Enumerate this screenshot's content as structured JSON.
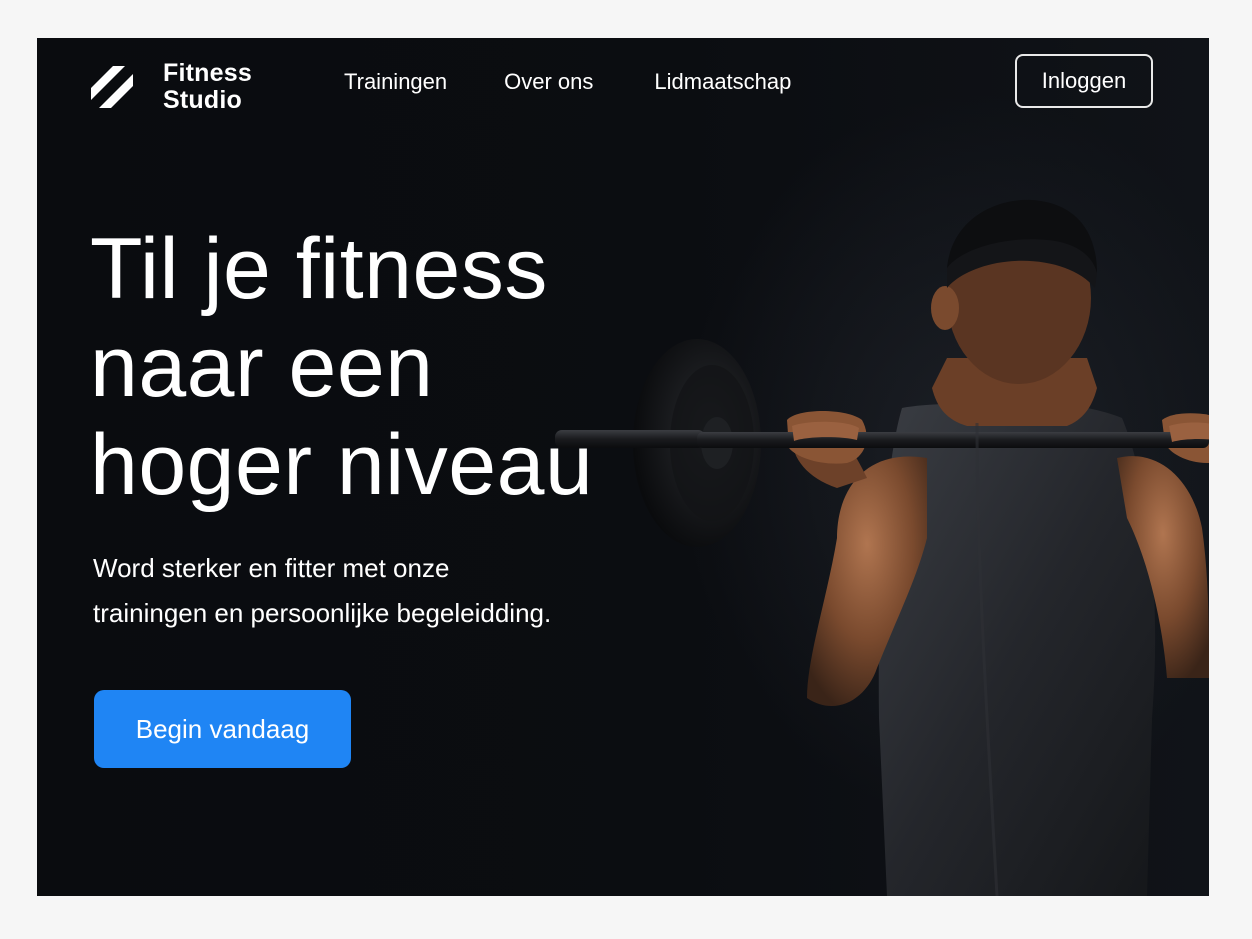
{
  "brand": {
    "name_line1": "Fitness",
    "name_line2": "Studio",
    "logo_icon": "diagonal-stripes-logo-icon"
  },
  "nav": {
    "links": [
      {
        "label": "Trainingen"
      },
      {
        "label": "Over ons"
      },
      {
        "label": "Lidmaatschap"
      }
    ],
    "login_label": "Inloggen"
  },
  "hero": {
    "headline_line1": "Til je fitness",
    "headline_line2": "naar een",
    "headline_line3": "hoger niveau",
    "subtext_line1": "Word sterker en fitter met onze",
    "subtext_line2": "trainingen en persoonlijke begeleidding.",
    "cta_label": "Begin vandaag",
    "image": "man-lifting-barbell-photo"
  },
  "colors": {
    "background": "#0b0d10",
    "accent": "#1f85f4",
    "text": "#ffffff"
  }
}
